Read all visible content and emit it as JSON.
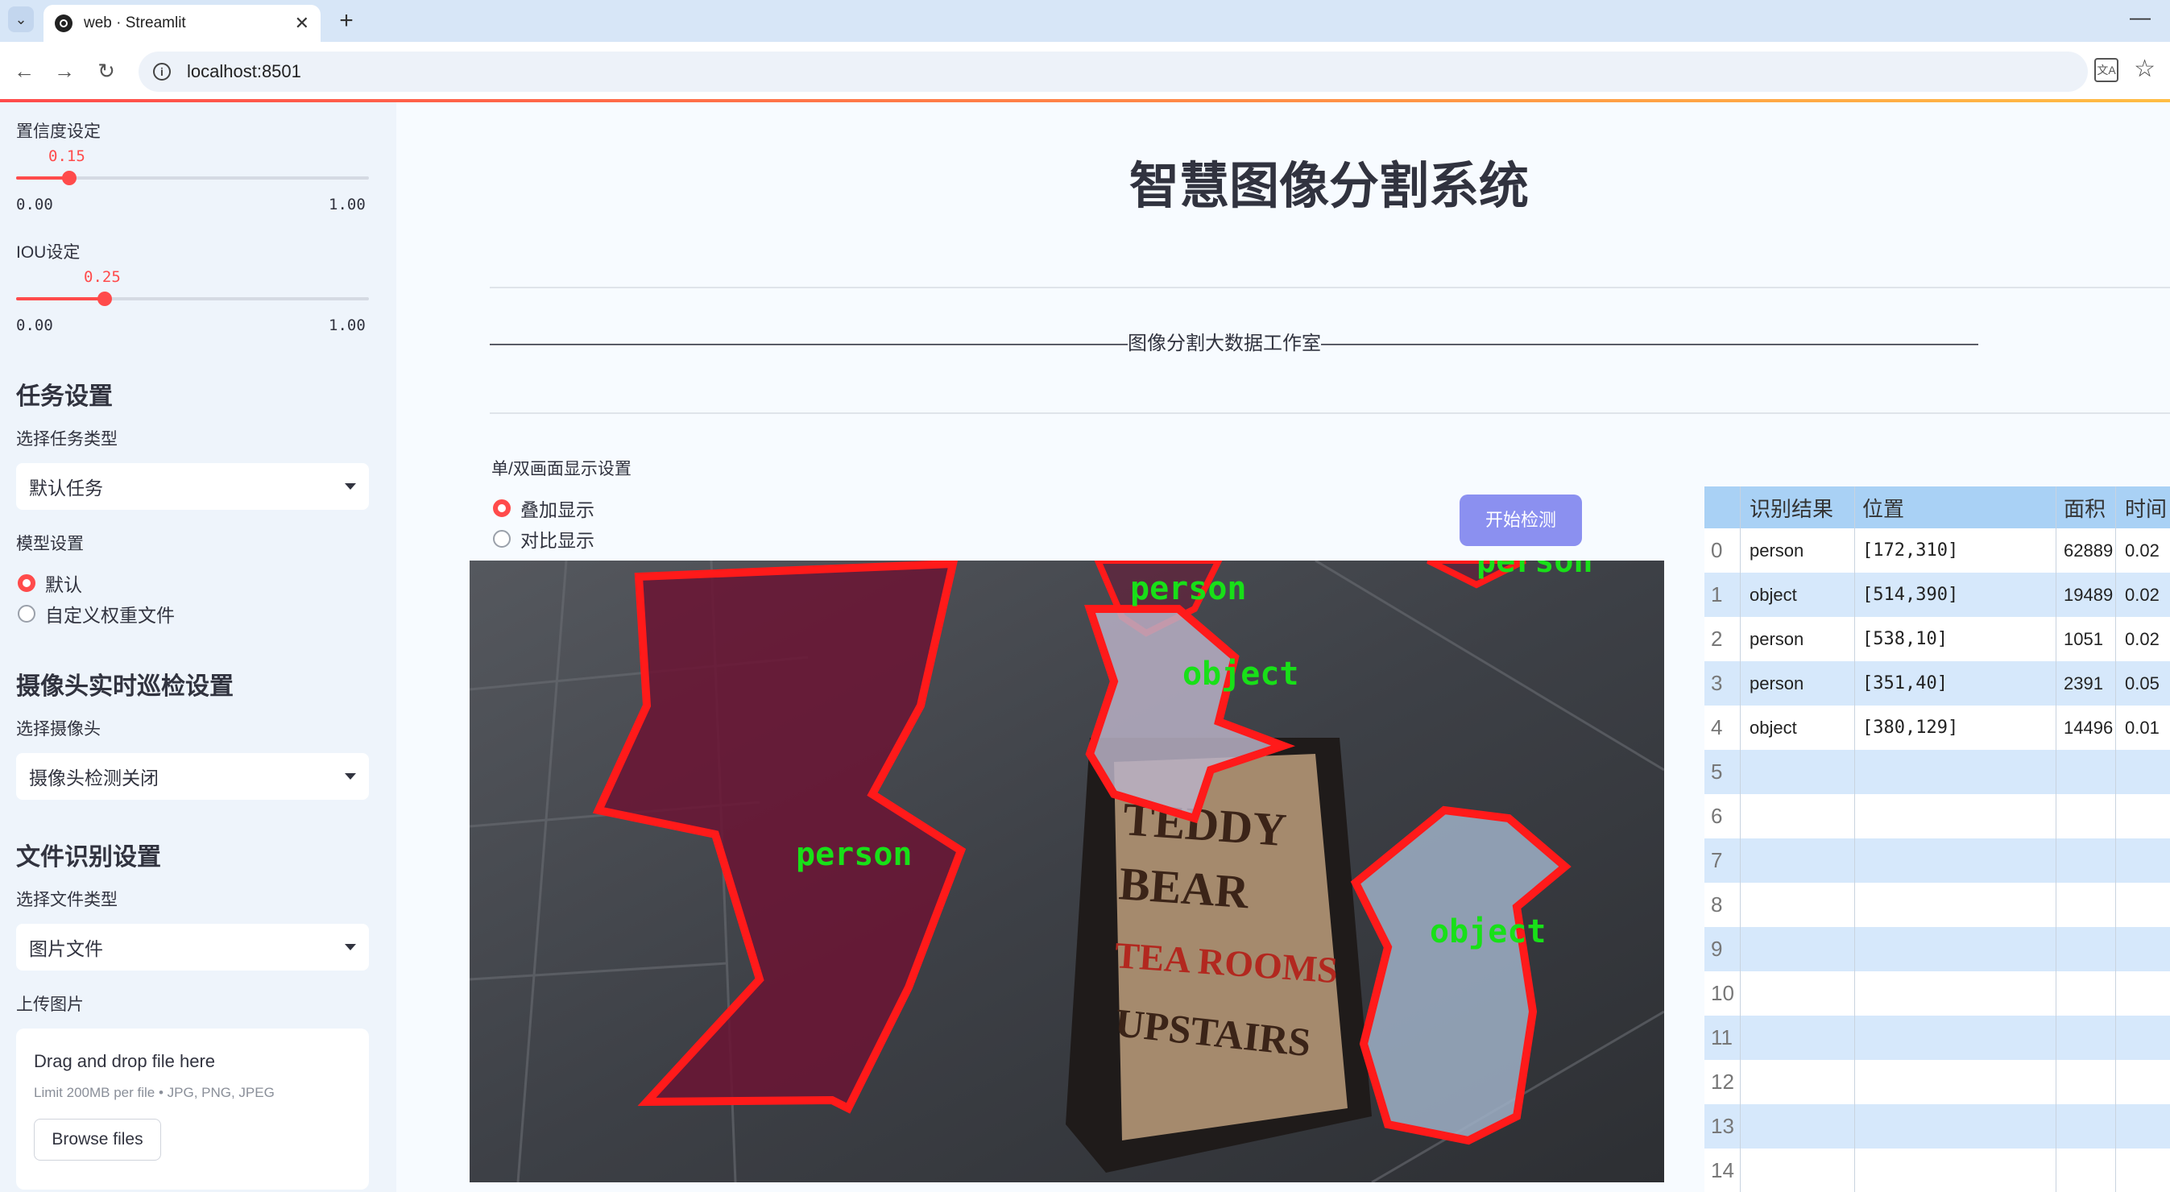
{
  "browser": {
    "tab_title": "web · Streamlit",
    "url": "localhost:8501"
  },
  "sidebar": {
    "confidence": {
      "label": "置信度设定",
      "value": "0.15",
      "min": "0.00",
      "max": "1.00",
      "fraction": 0.15
    },
    "iou": {
      "label": "IOU设定",
      "value": "0.25",
      "min": "0.00",
      "max": "1.00",
      "fraction": 0.25
    },
    "task_heading": "任务设置",
    "task_type_label": "选择任务类型",
    "task_type_value": "默认任务",
    "model_label": "模型设置",
    "model_options": [
      "默认",
      "自定义权重文件"
    ],
    "model_selected": 0,
    "camera_heading": "摄像头实时巡检设置",
    "camera_label": "选择摄像头",
    "camera_value": "摄像头检测关闭",
    "file_heading": "文件识别设置",
    "file_type_label": "选择文件类型",
    "file_type_value": "图片文件",
    "upload_label": "上传图片",
    "uploader": {
      "title": "Drag and drop file here",
      "limit": "Limit 200MB per file • JPG, PNG, JPEG",
      "button": "Browse files"
    }
  },
  "main": {
    "title": "智慧图像分割系统",
    "divider_text": "—————————————————————————————————图像分割大数据工作室——————————————————————————————————",
    "display_mode_label": "单/双画面显示设置",
    "display_modes": [
      "叠加显示",
      "对比显示"
    ],
    "display_selected": 0,
    "start_button": "开始检测"
  },
  "image": {
    "detection_labels": [
      "person",
      "person",
      "person",
      "object",
      "object"
    ]
  },
  "table": {
    "headers": [
      "",
      "识别结果",
      "位置",
      "面积",
      "时间"
    ],
    "rows": [
      [
        "0",
        "person",
        "[172,310]",
        "62889",
        "0.02"
      ],
      [
        "1",
        "object",
        "[514,390]",
        "19489",
        "0.02"
      ],
      [
        "2",
        "person",
        "[538,10]",
        "1051",
        "0.02"
      ],
      [
        "3",
        "person",
        "[351,40]",
        "2391",
        "0.05"
      ],
      [
        "4",
        "object",
        "[380,129]",
        "14496",
        "0.01"
      ],
      [
        "5",
        "",
        "",
        "",
        ""
      ],
      [
        "6",
        "",
        "",
        "",
        ""
      ],
      [
        "7",
        "",
        "",
        "",
        ""
      ],
      [
        "8",
        "",
        "",
        "",
        ""
      ],
      [
        "9",
        "",
        "",
        "",
        ""
      ],
      [
        "10",
        "",
        "",
        "",
        ""
      ],
      [
        "11",
        "",
        "",
        "",
        ""
      ],
      [
        "12",
        "",
        "",
        "",
        ""
      ],
      [
        "13",
        "",
        "",
        "",
        ""
      ],
      [
        "14",
        "",
        "",
        "",
        ""
      ]
    ]
  },
  "colors": {
    "accent": "#ff4b4b",
    "button": "#8b90f0",
    "table_header": "#a9d1f5",
    "table_stripe": "#d6e8fb",
    "mask_outline": "#ff1a1a",
    "label_text": "#18e018"
  }
}
